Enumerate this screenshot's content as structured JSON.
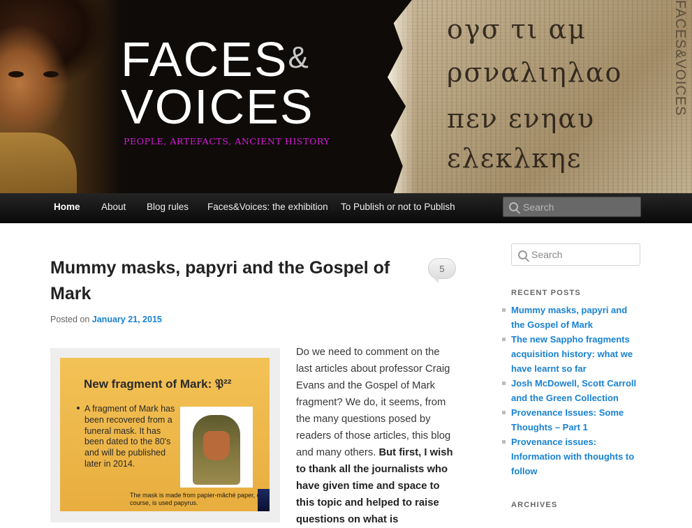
{
  "header": {
    "logo_line1": "FACES",
    "logo_amp": "&",
    "logo_line2": "VOICES",
    "tagline": "PEOPLE, ARTEFACTS, ANCIENT HISTORY",
    "side_text": "FACES&VOICES"
  },
  "nav": {
    "items": [
      {
        "label": "Home",
        "active": true
      },
      {
        "label": "About"
      },
      {
        "label": "Blog rules"
      },
      {
        "label": "Faces&Voices: the exhibition"
      },
      {
        "label": "To Publish or not to Publish"
      }
    ],
    "search_placeholder": "Search"
  },
  "post": {
    "title": "Mummy masks, papyri and the Gospel of Mark",
    "comment_count": "5",
    "posted_on_label": "Posted on",
    "date": "January 21, 2015",
    "slide": {
      "title": "New fragment of Mark: 𝔓²²",
      "text": "A fragment of Mark has been recovered from a funeral mask. It has been dated to the 80's and will be published later in 2014.",
      "note": "The mask is made from papier-mâché paper, of course, is used papyrus."
    },
    "body_plain": "Do we need to comment on the last articles about professor Craig Evans and the Gospel of Mark fragment? We do, it seems, from the many questions posed by readers of those articles, this blog and many others. ",
    "body_bold": "But first, I wish to thank all the journalists who have given time and space to this topic and helped to raise questions on what is"
  },
  "sidebar": {
    "search_placeholder": "Search",
    "recent_title": "RECENT POSTS",
    "recent_posts": [
      "Mummy masks, papyri and the Gospel of Mark",
      "The new Sappho fragments acquisition history: what we have learnt so far",
      "Josh McDowell, Scott Carroll and the Green Collection",
      "Provenance Issues: Some Thoughts – Part 1",
      "Provenance issues: Information with thoughts to follow"
    ],
    "archives_title": "ARCHIVES"
  },
  "colors": {
    "link": "#1982d1",
    "tagline": "#d81ad8",
    "nav_bg": "#111111"
  }
}
